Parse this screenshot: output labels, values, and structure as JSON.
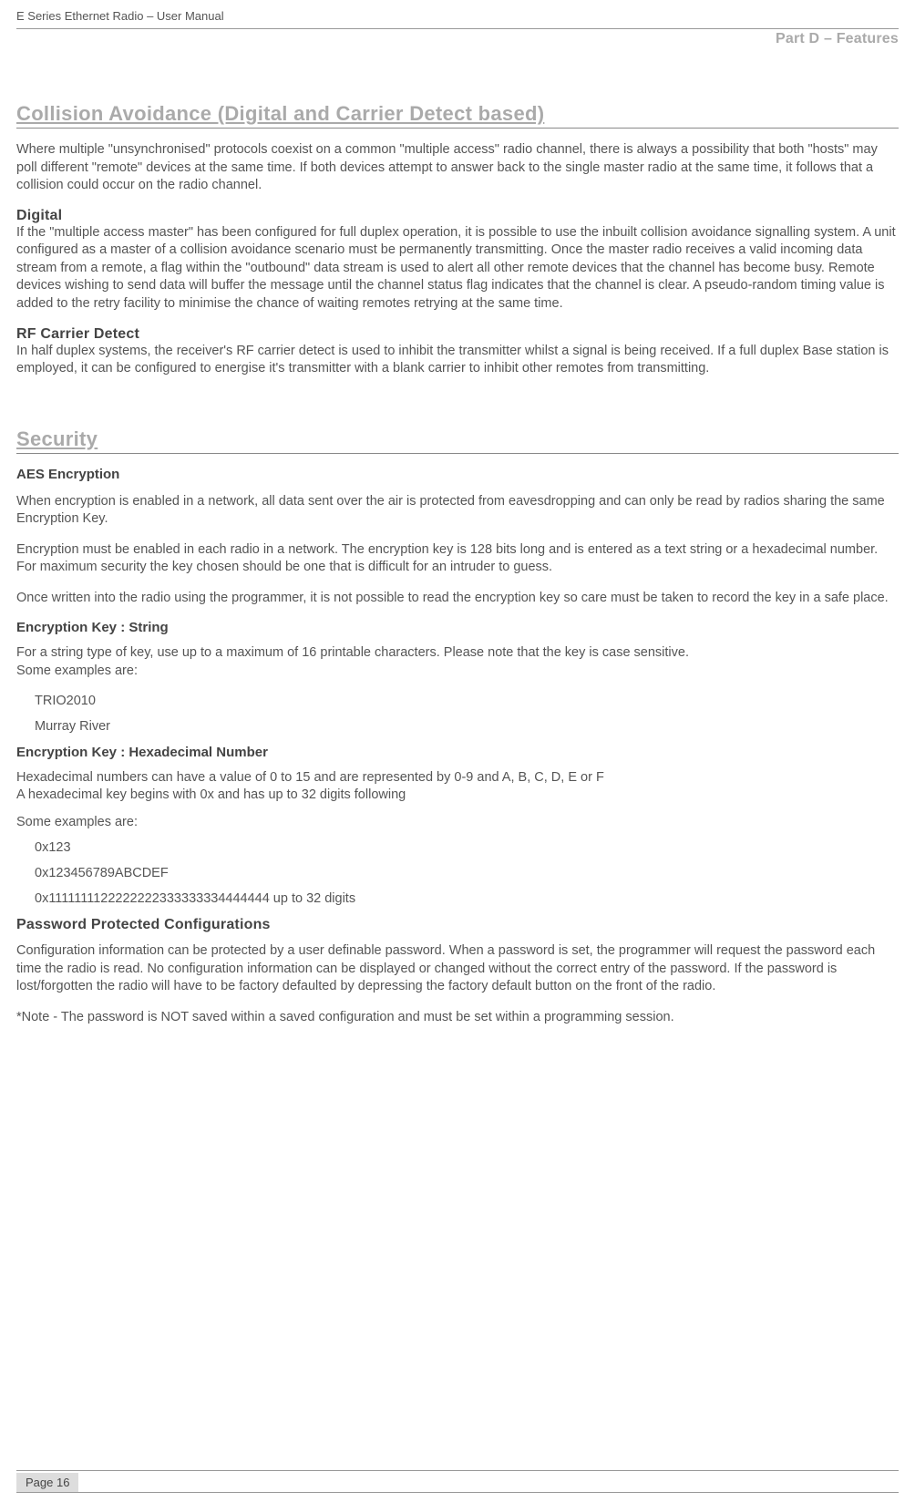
{
  "header": {
    "doc_title": "E Series Ethernet Radio – User Manual",
    "part_label": "Part D – Features"
  },
  "section_collision": {
    "heading": "Collision Avoidance (Digital and Carrier Detect based)",
    "intro": "Where multiple \"unsynchronised\" protocols coexist on a common \"multiple access\" radio channel, there is always a possibility that both \"hosts\" may poll different \"remote\" devices at the same time. If both devices attempt to answer back to the single master radio at the same time, it follows that a collision could occur on the radio channel.",
    "digital": {
      "title": "Digital",
      "body": "If the \"multiple access master\" has been configured for full duplex operation, it is possible to use the inbuilt collision avoidance signalling system. A unit configured as a master of a collision avoidance scenario must be permanently transmitting. Once the master radio receives a valid incoming data stream from a remote, a flag within the \"outbound\" data stream is used to alert all other remote devices that the channel has become busy. Remote devices wishing to send data will buffer the message until the channel status flag indicates that the channel is clear. A pseudo-random timing value is added to the retry facility to minimise the chance of waiting remotes retrying at the same time."
    },
    "rf_carrier": {
      "title": "RF Carrier Detect",
      "body": "In half duplex systems, the receiver's RF carrier detect is used to inhibit the transmitter whilst a signal is being received. If a full duplex Base station is employed, it can be configured to energise it's transmitter with a blank carrier to inhibit other remotes from transmitting."
    }
  },
  "section_security": {
    "heading": "Security",
    "aes": {
      "title": "AES Encryption",
      "p1": "When encryption is enabled in a network, all data sent over the air is protected from eavesdropping and can only be read by radios sharing the same Encryption Key.",
      "p2": "Encryption must be enabled in each radio in a network. The encryption key is 128 bits long and is entered as a text string or a hexadecimal number. For maximum security the key chosen should be one that is difficult for an intruder to guess.",
      "p3": "Once written into the radio using the programmer, it is not possible to read the encryption key so care must be taken to record the key in a safe place."
    },
    "key_string": {
      "title": "Encryption Key : String",
      "intro": "For a string type of key, use up to a maximum of 16 printable characters. Please note that the key is case sensitive.\nSome examples are:",
      "examples": [
        "TRIO2010",
        "Murray River"
      ]
    },
    "key_hex": {
      "title": "Encryption Key : Hexadecimal Number",
      "intro": "Hexadecimal numbers can have a value of 0 to 15 and are represented by 0-9 and A, B, C, D, E or F\nA hexadecimal key begins with 0x and has up to 32 digits following",
      "examples_label": "Some examples are:",
      "examples": [
        "0x123",
        "0x123456789ABCDEF",
        "0x1111111122222222333333334444444 up to 32 digits"
      ]
    },
    "password": {
      "title": "Password Protected Configurations",
      "body": "Configuration information can be protected by a user definable password. When a password is set, the programmer will request the password each time the radio is read. No configuration information can be displayed or changed without the correct entry of the password. If the password is lost/forgotten the radio will have to be factory defaulted by depressing the factory default button on the front of the radio.",
      "note": "*Note - The password is NOT saved within a saved configuration and must be set within a programming session."
    }
  },
  "footer": {
    "page_label": "Page 16"
  }
}
